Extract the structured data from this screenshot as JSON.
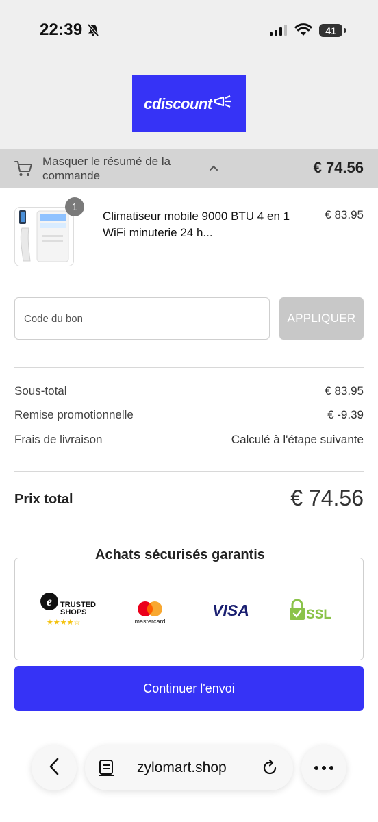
{
  "status_bar": {
    "time": "22:39",
    "battery": "41"
  },
  "header": {
    "logo_text": "cdiscount",
    "brand_color": "#3633f6"
  },
  "summary": {
    "toggle_label": "Masquer le résumé de la commande",
    "total": "€ 74.56"
  },
  "product": {
    "quantity": "1",
    "name": "Climatiseur mobile 9000 BTU 4 en 1 WiFi minuterie 24 h...",
    "price": "€ 83.95"
  },
  "voucher": {
    "placeholder": "Code du bon",
    "apply_label": "APPLIQUER"
  },
  "lines": [
    {
      "label": "Sous-total",
      "value": "€ 83.95"
    },
    {
      "label": "Remise promotionnelle",
      "value": "€ -9.39"
    },
    {
      "label": "Frais de livraison",
      "value": "Calculé à l'étape suivante"
    }
  ],
  "total": {
    "label": "Prix total",
    "value": "€ 74.56"
  },
  "secure": {
    "title": "Achats sécurisés garantis",
    "badges": {
      "trusted_line1": "TRUSTED",
      "trusted_line2": "SHOPS",
      "mastercard": "mastercard",
      "visa": "VISA",
      "ssl": "SSL"
    }
  },
  "continue_label": "Continuer l'envoi",
  "browser": {
    "url": "zylomart.shop"
  }
}
